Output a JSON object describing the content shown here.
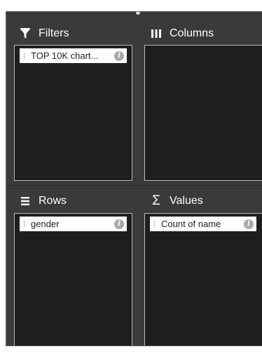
{
  "sections": {
    "filters": {
      "title": "Filters",
      "icon": "filter-icon",
      "items": [
        {
          "label": "TOP 10K chart..."
        }
      ]
    },
    "columns": {
      "title": "Columns",
      "icon": "columns-icon",
      "items": []
    },
    "rows": {
      "title": "Rows",
      "icon": "rows-icon",
      "items": [
        {
          "label": "gender"
        }
      ]
    },
    "values": {
      "title": "Values",
      "icon": "sigma-icon",
      "items": [
        {
          "label": "Count of name"
        }
      ]
    }
  },
  "pill_info_glyph": "i",
  "values_symbol": "Σ",
  "colors": {
    "panel_bg": "#3a3a3a",
    "zone_bg": "#1e1e1e",
    "zone_border": "#b8b8b8",
    "pill_bg": "#ffffff",
    "info_icon": "#a9a9a9"
  }
}
